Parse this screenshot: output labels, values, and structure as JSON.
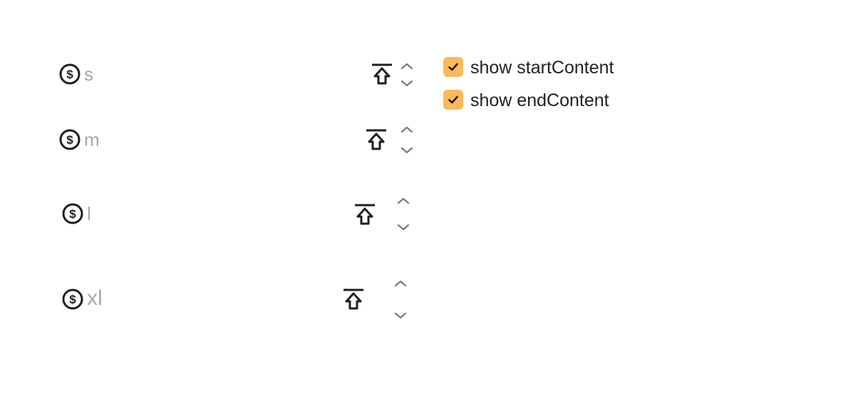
{
  "fields": [
    {
      "size": "s",
      "value": "s",
      "start_icon": "dollar-circle-icon",
      "end_icon": "upload-to-top-icon",
      "increment_icon": "chevron-up-icon",
      "decrement_icon": "chevron-down-icon"
    },
    {
      "size": "m",
      "value": "m",
      "start_icon": "dollar-circle-icon",
      "end_icon": "upload-to-top-icon",
      "increment_icon": "chevron-up-icon",
      "decrement_icon": "chevron-down-icon"
    },
    {
      "size": "l",
      "value": "l",
      "start_icon": "dollar-circle-icon",
      "end_icon": "upload-to-top-icon",
      "increment_icon": "chevron-up-icon",
      "decrement_icon": "chevron-down-icon"
    },
    {
      "size": "xl",
      "value": "xl",
      "start_icon": "dollar-circle-icon",
      "end_icon": "upload-to-top-icon",
      "increment_icon": "chevron-up-icon",
      "decrement_icon": "chevron-down-icon"
    }
  ],
  "options": [
    {
      "label": "show startContent",
      "checked": true
    },
    {
      "label": "show endContent",
      "checked": true
    }
  ],
  "colors": {
    "checkbox_accent": "#fcb95a",
    "value_text": "#a8a8a8",
    "icon": "#1f1f1f",
    "chevron": "#7a7a7a",
    "label_text": "#222222"
  }
}
